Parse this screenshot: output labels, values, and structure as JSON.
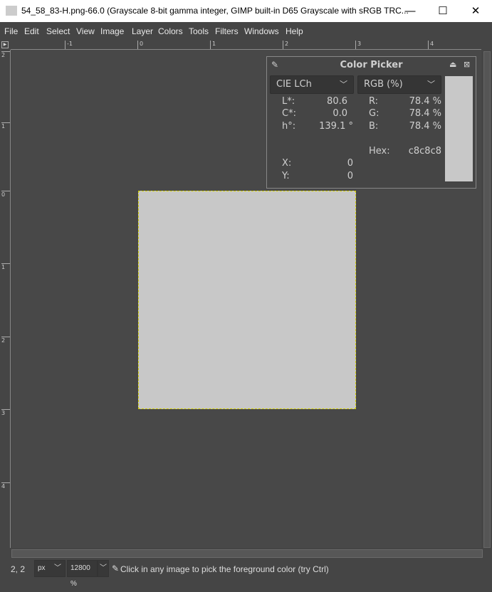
{
  "window": {
    "title": "54_58_83-H.png-66.0 (Grayscale 8-bit gamma integer, GIMP built-in D65 Grayscale with sRGB TRC...",
    "minimize": "—",
    "maximize": "☐",
    "close": "✕"
  },
  "menu": [
    "File",
    "Edit",
    "Select",
    "View",
    "Image",
    "Layer",
    "Colors",
    "Tools",
    "Filters",
    "Windows",
    "Help"
  ],
  "hruler": [
    "-1",
    "0",
    "1",
    "2",
    "3",
    "4"
  ],
  "vruler": [
    "2",
    "1",
    "0",
    "1",
    "2",
    "3",
    "4"
  ],
  "color_picker": {
    "title": "Color Picker",
    "mode1": "CIE LCh",
    "mode2": "RGB (%)",
    "left": [
      {
        "label": "L*:",
        "value": "80.6"
      },
      {
        "label": "C*:",
        "value": "0.0"
      },
      {
        "label": "h°:",
        "value": "139.1 °"
      }
    ],
    "right": [
      {
        "label": "R:",
        "value": "78.4 %"
      },
      {
        "label": "G:",
        "value": "78.4 %"
      },
      {
        "label": "B:",
        "value": "78.4 %"
      }
    ],
    "hex_label": "Hex:",
    "hex": "c8c8c8",
    "x_label": "X:",
    "x": "0",
    "y_label": "Y:",
    "y": "0",
    "swatch_color": "#c8c8c8"
  },
  "status": {
    "coords": "2, 2",
    "unit": "px",
    "zoom": "12800 %",
    "message": "Click in any image to pick the foreground color (try Ctrl)"
  }
}
